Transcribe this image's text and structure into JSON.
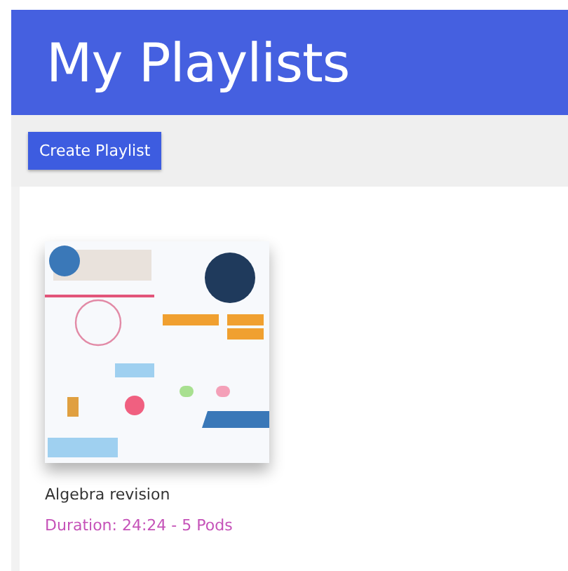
{
  "header": {
    "title": "My Playlists"
  },
  "toolbar": {
    "create_button": "Create Playlist"
  },
  "playlists": [
    {
      "title": "Algebra revision",
      "duration": "Duration: 24:24 - 5 Pods"
    }
  ]
}
